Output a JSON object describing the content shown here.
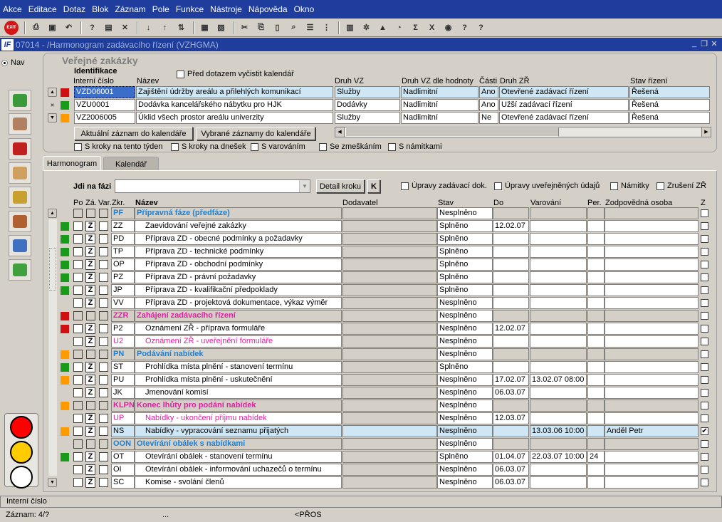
{
  "menu": [
    "Akce",
    "Editace",
    "Dotaz",
    "Blok",
    "Záznam",
    "Pole",
    "Funkce",
    "Nástroje",
    "Nápověda",
    "Okno"
  ],
  "toolbar": {
    "exit_label": "EXIT"
  },
  "window": {
    "title": "07014 - /Harmonogram zadávacího řízení (VZHGMA)",
    "logo": "IF"
  },
  "nav": {
    "label": "Nav"
  },
  "colors": {
    "green": "#1a9a1a",
    "red": "#d01010",
    "orange": "#ff9a00",
    "accent": "#1e3d9c",
    "selected": "#cfe7f5"
  },
  "panel1": {
    "legend": "Veřejné zakázky",
    "group_label": "Identifikace",
    "clear_label": "Před dotazem vyčistit kalendář",
    "headers": {
      "interni": "Interní číslo",
      "nazev": "Název",
      "druh": "Druh VZ",
      "druh_hodnota": "Druh VZ dle hodnoty",
      "casti": "Části",
      "druh_zr": "Druh ZŘ",
      "stav": "Stav řízení"
    },
    "rows": [
      {
        "color": "red",
        "interni": "VZD06001",
        "nazev": "Zajištění údržby areálu a přilehlých komunikací",
        "druh": "Služby",
        "hodnota": "Nadlimitní",
        "casti": "Ano",
        "druh_zr": "Otevřené zadávací řízení",
        "stav": "Řešená",
        "selected": true
      },
      {
        "color": "green",
        "interni": "VZU0001",
        "nazev": "Dodávka kancelářského nábytku pro HJK",
        "druh": "Dodávky",
        "hodnota": "Nadlimitní",
        "casti": "Ano",
        "druh_zr": "Užší zadávací řízení",
        "stav": "Řešená",
        "selected": false
      },
      {
        "color": "orange",
        "interni": "VZ2006005",
        "nazev": "Úklid všech prostor areálu univerzity",
        "druh": "Služby",
        "hodnota": "Nadlimitní",
        "casti": "Ne",
        "druh_zr": "Otevřené zadávací řízení",
        "stav": "Řešená",
        "selected": false
      }
    ],
    "btn_current": "Aktuální záznam do kalendáře",
    "btn_selected": "Vybrané záznamy do kalendáře",
    "filters": [
      "S kroky na tento týden",
      "S kroky na dnešek",
      "S varováním",
      "Se zmeškáním",
      "S námitkami"
    ]
  },
  "tabs": [
    "Harmonogram",
    "Kalendář"
  ],
  "harm": {
    "jdi_label": "Jdi na fázi",
    "jdi_value": "",
    "detail_btn": "Detail kroku",
    "k_btn": "K",
    "options": [
      "Úpravy zadávací dok.",
      "Úpravy uveřejněných údajů",
      "Námitky",
      "Zrušení ZŘ"
    ],
    "headers": {
      "po": "Po",
      "za": "Zá.",
      "var": "Var.",
      "zkr": "Zkr.",
      "nazev": "Název",
      "dodavatel": "Dodavatel",
      "stav": "Stav",
      "do": "Do",
      "varovani": "Varování",
      "per": "Per.",
      "osoba": "Zodpovědná osoba",
      "z": "Z"
    },
    "rows": [
      {
        "phase": true,
        "color": "",
        "zkr": "PF",
        "nazev": "Přípravná fáze (předfáze)",
        "stav": "Nesplněno",
        "do": "",
        "var": "",
        "per": "",
        "osoba": "",
        "z": false,
        "tone": "b"
      },
      {
        "phase": false,
        "color": "green",
        "zkr": "ZZ",
        "nazev": "Zaevidování veřejné zakázky",
        "stav": "Splněno",
        "do": "12.02.07",
        "var": "",
        "per": "",
        "osoba": "",
        "z": false,
        "tone": ""
      },
      {
        "phase": false,
        "color": "green",
        "zkr": "PD",
        "nazev": "Příprava ZD - obecné podmínky a požadavky",
        "stav": "Splněno",
        "do": "",
        "var": "",
        "per": "",
        "osoba": "",
        "z": false,
        "tone": ""
      },
      {
        "phase": false,
        "color": "green",
        "zkr": "TP",
        "nazev": "Příprava ZD - technické podmínky",
        "stav": "Splněno",
        "do": "",
        "var": "",
        "per": "",
        "osoba": "",
        "z": false,
        "tone": ""
      },
      {
        "phase": false,
        "color": "green",
        "zkr": "OP",
        "nazev": "Příprava ZD - obchodní podmínky",
        "stav": "Splněno",
        "do": "",
        "var": "",
        "per": "",
        "osoba": "",
        "z": false,
        "tone": ""
      },
      {
        "phase": false,
        "color": "green",
        "zkr": "PZ",
        "nazev": "Příprava ZD - právní požadavky",
        "stav": "Splněno",
        "do": "",
        "var": "",
        "per": "",
        "osoba": "",
        "z": false,
        "tone": ""
      },
      {
        "phase": false,
        "color": "green",
        "zkr": "JP",
        "nazev": "Příprava ZD - kvalifikační předpoklady",
        "stav": "Splněno",
        "do": "",
        "var": "",
        "per": "",
        "osoba": "",
        "z": false,
        "tone": ""
      },
      {
        "phase": false,
        "color": "",
        "zkr": "VV",
        "nazev": "Příprava ZD - projektová dokumentace, výkaz výměr",
        "stav": "Nesplněno",
        "do": "",
        "var": "",
        "per": "",
        "osoba": "",
        "z": false,
        "tone": ""
      },
      {
        "phase": true,
        "color": "red",
        "zkr": "ZZR",
        "nazev": "Zahájení zadávacího řízení",
        "stav": "Nesplněno",
        "do": "",
        "var": "",
        "per": "",
        "osoba": "",
        "z": false,
        "tone": "m"
      },
      {
        "phase": false,
        "color": "red",
        "zkr": "P2",
        "nazev": "Oznámení ZŘ - příprava formuláře",
        "stav": "Nesplněno",
        "do": "12.02.07",
        "var": "",
        "per": "",
        "osoba": "",
        "z": false,
        "tone": ""
      },
      {
        "phase": false,
        "color": "",
        "zkr": "U2",
        "nazev": "Oznámení ZŘ - uveřejnění formuláře",
        "stav": "Nesplněno",
        "do": "",
        "var": "",
        "per": "",
        "osoba": "",
        "z": false,
        "tone": "m"
      },
      {
        "phase": true,
        "color": "orange",
        "zkr": "PN",
        "nazev": "Podávání nabídek",
        "stav": "Nesplněno",
        "do": "",
        "var": "",
        "per": "",
        "osoba": "",
        "z": false,
        "tone": "b"
      },
      {
        "phase": false,
        "color": "green",
        "zkr": "ST",
        "nazev": "Prohlídka místa plnění - stanovení termínu",
        "stav": "Splněno",
        "do": "",
        "var": "",
        "per": "",
        "osoba": "",
        "z": false,
        "tone": ""
      },
      {
        "phase": false,
        "color": "orange",
        "zkr": "PU",
        "nazev": "Prohlídka místa plnění - uskutečnění",
        "stav": "Nesplněno",
        "do": "17.02.07",
        "var": "13.02.07 08:00",
        "per": "",
        "osoba": "",
        "z": false,
        "tone": ""
      },
      {
        "phase": false,
        "color": "",
        "zkr": "JK",
        "nazev": "Jmenování komisí",
        "stav": "Nesplněno",
        "do": "06.03.07",
        "var": "",
        "per": "",
        "osoba": "",
        "z": false,
        "tone": ""
      },
      {
        "phase": true,
        "color": "orange",
        "zkr": "KLPN",
        "nazev": "Konec lhůty pro podání nabídek",
        "stav": "Nesplněno",
        "do": "",
        "var": "",
        "per": "",
        "osoba": "",
        "z": false,
        "tone": "m"
      },
      {
        "phase": false,
        "color": "",
        "zkr": "UP",
        "nazev": "Nabídky - ukončení příjmu nabídek",
        "stav": "Nesplněno",
        "do": "12.03.07",
        "var": "",
        "per": "",
        "osoba": "",
        "z": false,
        "tone": "m"
      },
      {
        "phase": false,
        "color": "orange",
        "zkr": "NS",
        "nazev": "Nabídky - vypracování seznamu přijatých",
        "stav": "Nesplněno",
        "do": "",
        "var": "13.03.06 10:00",
        "per": "",
        "osoba": "Anděl Petr",
        "z": true,
        "tone": "",
        "selected": true
      },
      {
        "phase": true,
        "color": "",
        "zkr": "OON",
        "nazev": "Otevírání obálek s nabídkami",
        "stav": "Nesplněno",
        "do": "",
        "var": "",
        "per": "",
        "osoba": "",
        "z": false,
        "tone": "b"
      },
      {
        "phase": false,
        "color": "green",
        "zkr": "OT",
        "nazev": "Otevírání obálek - stanovení termínu",
        "stav": "Splněno",
        "do": "01.04.07",
        "var": "22.03.07 10:00",
        "per": "24",
        "osoba": "",
        "z": false,
        "tone": ""
      },
      {
        "phase": false,
        "color": "",
        "zkr": "OI",
        "nazev": "Otevírání obálek - informování uchazečů o termínu",
        "stav": "Nesplněno",
        "do": "06.03.07",
        "var": "",
        "per": "",
        "osoba": "",
        "z": false,
        "tone": ""
      },
      {
        "phase": false,
        "color": "",
        "zkr": "SC",
        "nazev": "Komise - svolání členů",
        "stav": "Nesplněno",
        "do": "06.03.07",
        "var": "",
        "per": "",
        "osoba": "",
        "z": false,
        "tone": ""
      }
    ],
    "z_mark": "Z",
    "check_mark": "✔"
  },
  "status": {
    "field_hint": "Interní číslo",
    "record": "Záznam: 4/?",
    "dots": "...",
    "mode": "<PŘOS"
  }
}
